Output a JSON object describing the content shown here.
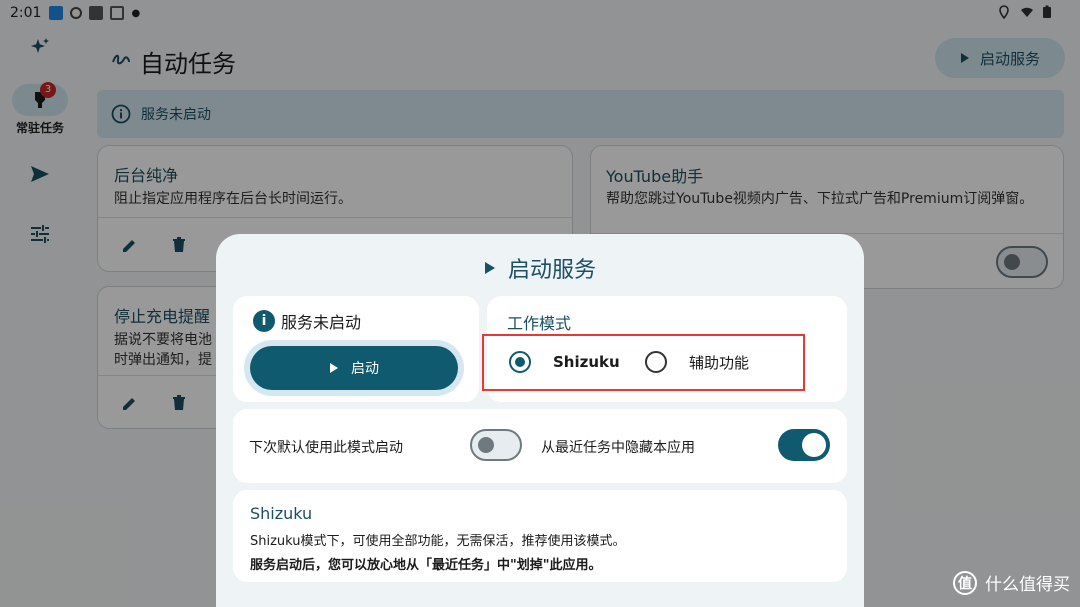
{
  "status_bar": {
    "time": "2:01"
  },
  "nav_rail": {
    "items": [
      {
        "name": "sparkle",
        "label": ""
      },
      {
        "name": "resident-tasks",
        "label": "常驻任务",
        "badge": "3"
      },
      {
        "name": "send",
        "label": ""
      },
      {
        "name": "tune",
        "label": ""
      }
    ]
  },
  "header": {
    "title": "自动任务",
    "start_service_label": "启动服务"
  },
  "banner": {
    "text": "服务未启动"
  },
  "cards": [
    {
      "title": "后台纯净",
      "desc": "阻止指定应用程序在后台长时间运行。"
    },
    {
      "title": "YouTube助手",
      "desc": "帮助您跳过YouTube视频内广告、下拉式广告和Premium订阅弹窗。"
    },
    {
      "title": "停止充电提醒",
      "desc_line1": "据说不要将电池",
      "desc_line2": "时弹出通知，提"
    }
  ],
  "dialog": {
    "title": "启动服务",
    "status_text": "服务未启动",
    "start_button_label": "启动",
    "mode_section_title": "工作模式",
    "modes": [
      {
        "label": "Shizuku",
        "selected": true
      },
      {
        "label": "辅助功能",
        "selected": false
      }
    ],
    "options": [
      {
        "label": "下次默认使用此模式启动",
        "enabled": false
      },
      {
        "label": "从最近任务中隐藏本应用",
        "enabled": true
      }
    ],
    "description": {
      "title": "Shizuku",
      "line1": "Shizuku模式下，可使用全部功能，无需保活，推荐使用该模式。",
      "line2": "服务启动后，您可以放心地从「最近任务」中\"划掉\"此应用。"
    }
  },
  "watermark": {
    "text": "什么值得买",
    "logo_glyph": "值"
  },
  "colors": {
    "primary": "#0f5a6e",
    "highlight_box": "#e53935",
    "container": "#cfe6ef"
  }
}
